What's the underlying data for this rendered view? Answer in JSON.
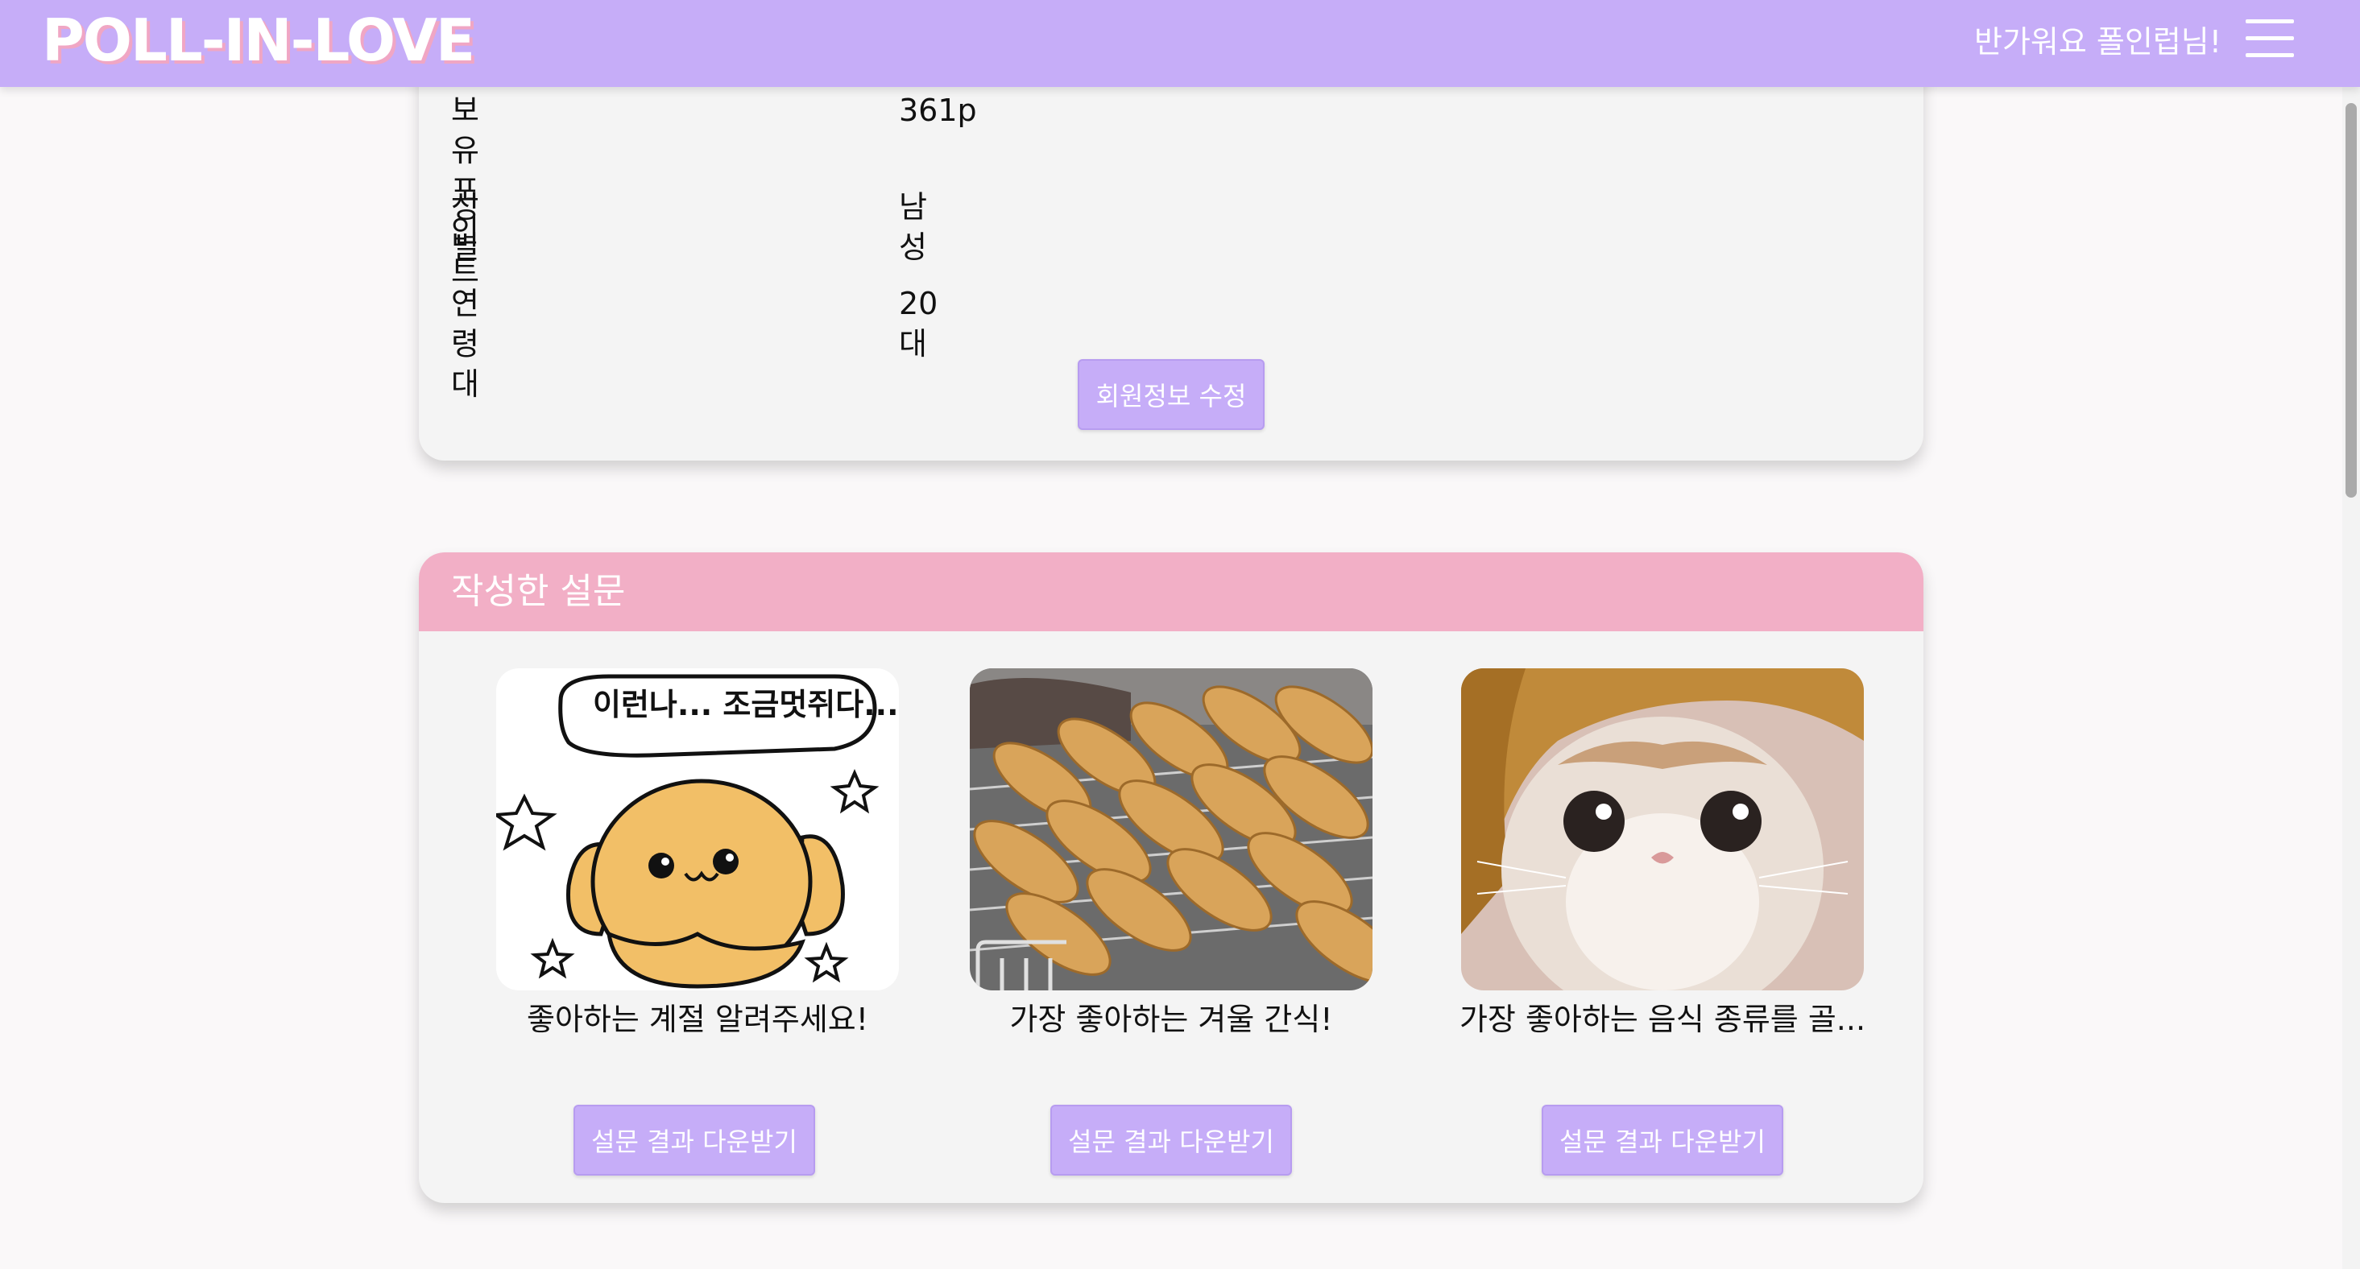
{
  "header": {
    "logo": "POLL-IN-LOVE",
    "greeting": "반가워요 폴인럽님!",
    "menu_icon": "hamburger-menu-icon"
  },
  "profile": {
    "rows": [
      {
        "label": "보유 포인트",
        "value": "361p"
      },
      {
        "label": "성별",
        "value": "남성"
      },
      {
        "label": "연령대",
        "value": "20대"
      }
    ],
    "edit_button": "회원정보 수정"
  },
  "surveys": {
    "section_title": "작성한 설문",
    "items": [
      {
        "title": "좋아하는 계절 알려주세요!",
        "button": "설문 결과 다운받기",
        "image": "cartoon-dog-thumbnail",
        "image_caption": "이런나... 조금멋쥐다...!"
      },
      {
        "title": "가장 좋아하는 겨울 간식!",
        "button": "설문 결과 다운받기",
        "image": "fish-bread-thumbnail"
      },
      {
        "title": "가장 좋아하는 음식 종류를 골...",
        "button": "설문 결과 다운받기",
        "image": "kitten-thumbnail"
      }
    ]
  },
  "colors": {
    "header_bg": "#c6adf8",
    "section_header_bg": "#f2afc6",
    "button_bg": "#c6adf8",
    "card_bg": "#f4f4f4"
  }
}
